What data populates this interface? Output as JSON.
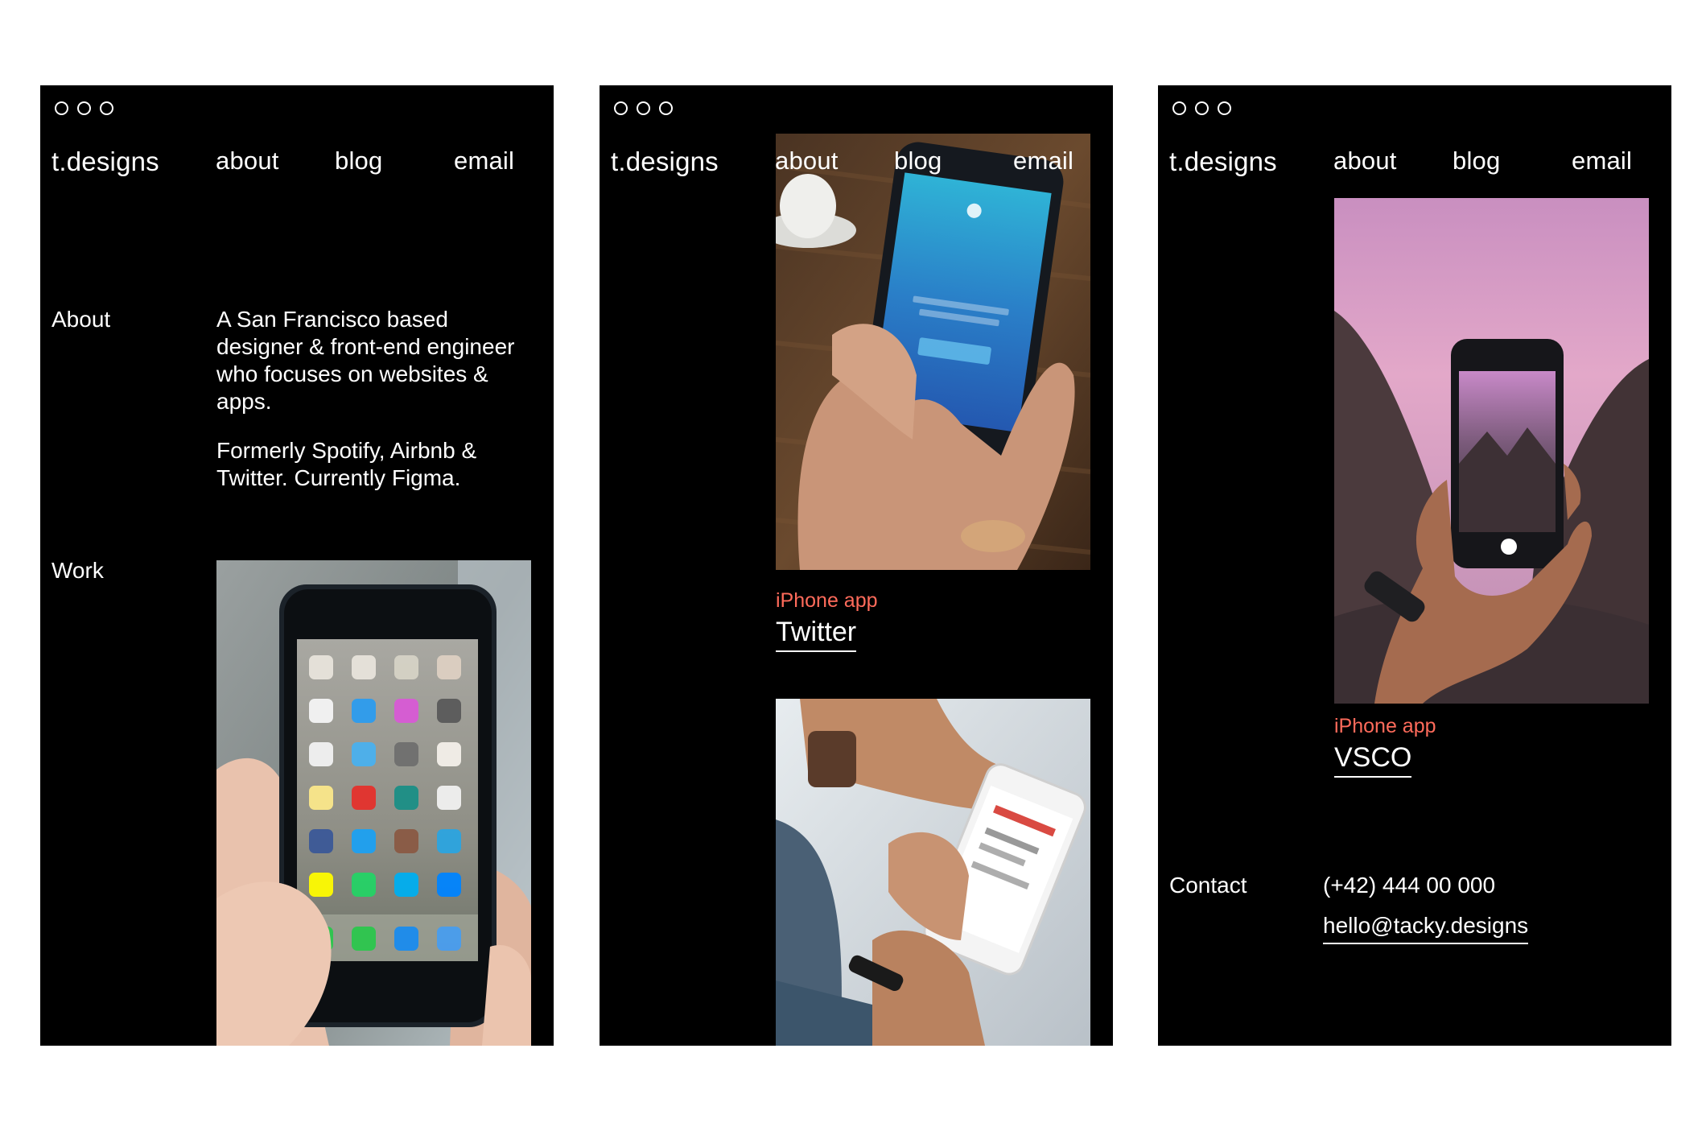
{
  "accent_color": "#ff6b5b",
  "window_controls": [
    "dot",
    "dot",
    "dot"
  ],
  "nav": {
    "logo": "t.designs",
    "about": "about",
    "blog": "blog",
    "email": "email"
  },
  "panel1": {
    "about_heading": "About",
    "bio_p1": "A San Francisco based designer & front-end engineer who focuses on websites & apps.",
    "bio_p2": "Formerly Spotify, Airbnb & Twitter. Currently Figma.",
    "work_heading": "Work"
  },
  "panel2": {
    "project_kind": "iPhone app",
    "project_title": "Twitter"
  },
  "panel3": {
    "project_kind": "iPhone app",
    "project_title": "VSCO",
    "contact_heading": "Contact",
    "phone": "(+42) 444 00 000",
    "email": "hello@tacky.designs"
  }
}
